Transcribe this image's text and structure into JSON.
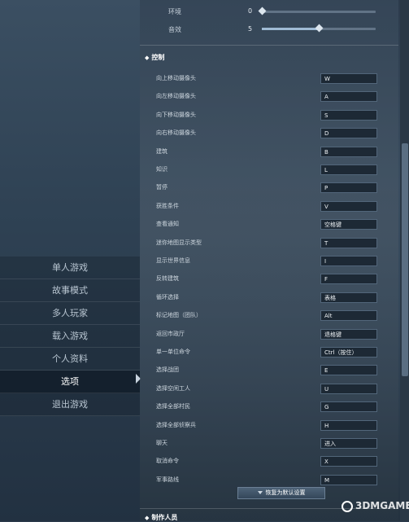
{
  "main_menu": {
    "items": [
      {
        "label": "单人游戏"
      },
      {
        "label": "故事模式"
      },
      {
        "label": "多人玩家"
      },
      {
        "label": "载入游戏"
      },
      {
        "label": "个人资料"
      },
      {
        "label": "选项",
        "active": true
      },
      {
        "label": "退出游戏"
      }
    ]
  },
  "audio": {
    "rows": [
      {
        "label": "环境",
        "value": "0",
        "level": 0.0
      },
      {
        "label": "音效",
        "value": "5",
        "level": 0.5
      }
    ]
  },
  "controls": {
    "title": "控制",
    "bindings": [
      {
        "label": "向上移动摄像头",
        "key": "W"
      },
      {
        "label": "向左移动摄像头",
        "key": "A"
      },
      {
        "label": "向下移动摄像头",
        "key": "S"
      },
      {
        "label": "向右移动摄像头",
        "key": "D"
      },
      {
        "label": "建筑",
        "key": "B"
      },
      {
        "label": "知识",
        "key": "L"
      },
      {
        "label": "暂停",
        "key": "P"
      },
      {
        "label": "获胜条件",
        "key": "V"
      },
      {
        "label": "查看通知",
        "key": "空格键"
      },
      {
        "label": "迷你地图显示类型",
        "key": "T"
      },
      {
        "label": "显示世界信息",
        "key": "I"
      },
      {
        "label": "反转建筑",
        "key": "F"
      },
      {
        "label": "循环选择",
        "key": "表格"
      },
      {
        "label": "标记地图（团队）",
        "key": "Alt"
      },
      {
        "label": "返回市政厅",
        "key": "退格键"
      },
      {
        "label": "单一单位命令",
        "key": "Ctrl（按住）"
      },
      {
        "label": "选择战团",
        "key": "E"
      },
      {
        "label": "选择空闲工人",
        "key": "U"
      },
      {
        "label": "选择全部村民",
        "key": "G"
      },
      {
        "label": "选择全部侦察兵",
        "key": "H"
      },
      {
        "label": "聊天",
        "key": "进入"
      },
      {
        "label": "取消命令",
        "key": "X"
      },
      {
        "label": "军事路线",
        "key": "M"
      }
    ],
    "reset_label": "恢复为默认设置"
  },
  "credits": {
    "title": "制作人员"
  },
  "watermark": {
    "text": "3DMGAME"
  }
}
